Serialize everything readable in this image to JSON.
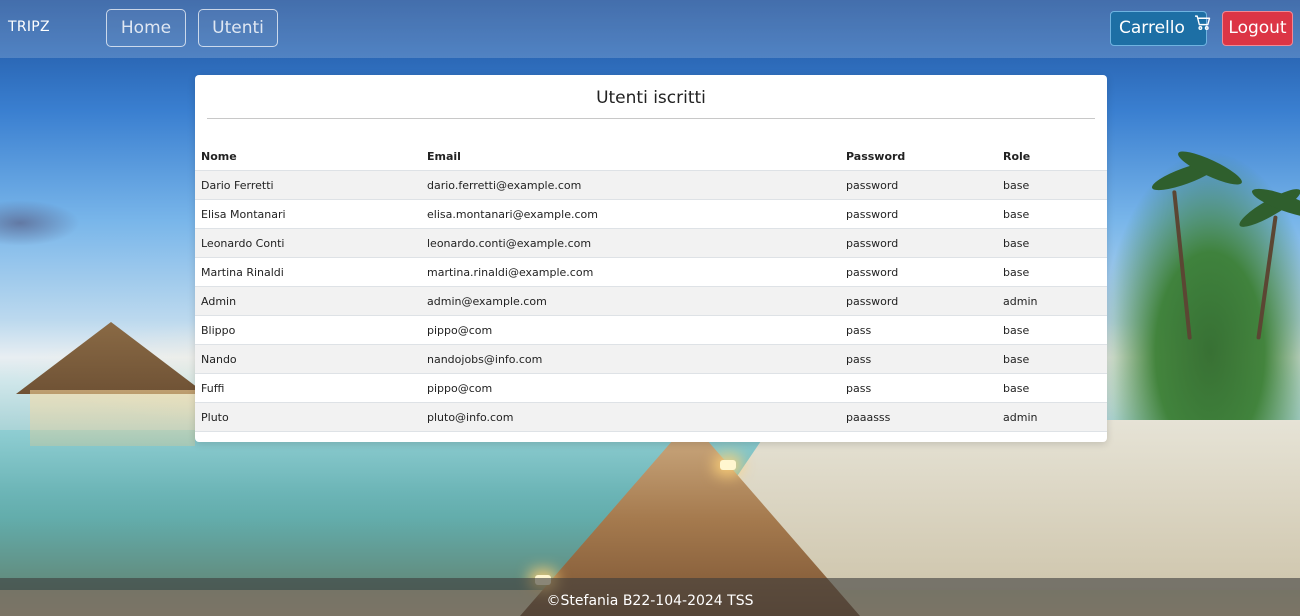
{
  "navbar": {
    "brand": "TRIPZ",
    "home_label": "Home",
    "utenti_label": "Utenti",
    "cart_label": "Carrello",
    "cart_icon": "shopping-cart-icon",
    "logout_label": "Logout"
  },
  "card": {
    "title": "Utenti iscritti",
    "columns": [
      "Nome",
      "Email",
      "Password",
      "Role"
    ],
    "rows": [
      [
        "Dario Ferretti",
        "dario.ferretti@example.com",
        "password",
        "base"
      ],
      [
        "Elisa Montanari",
        "elisa.montanari@example.com",
        "password",
        "base"
      ],
      [
        "Leonardo Conti",
        "leonardo.conti@example.com",
        "password",
        "base"
      ],
      [
        "Martina Rinaldi",
        "martina.rinaldi@example.com",
        "password",
        "base"
      ],
      [
        "Admin",
        "admin@example.com",
        "password",
        "admin"
      ],
      [
        "Blippo",
        "pippo@com",
        "pass",
        "base"
      ],
      [
        "Nando",
        "nandojobs@info.com",
        "pass",
        "base"
      ],
      [
        "Fuffi",
        "pippo@com",
        "pass",
        "base"
      ],
      [
        "Pluto",
        "pluto@info.com",
        "paaasss",
        "admin"
      ]
    ]
  },
  "footer": {
    "text": "©Stefania B22-104-2024 TSS"
  },
  "colors": {
    "cart_button": "#1d6fa5",
    "logout_button": "#dc3545"
  }
}
